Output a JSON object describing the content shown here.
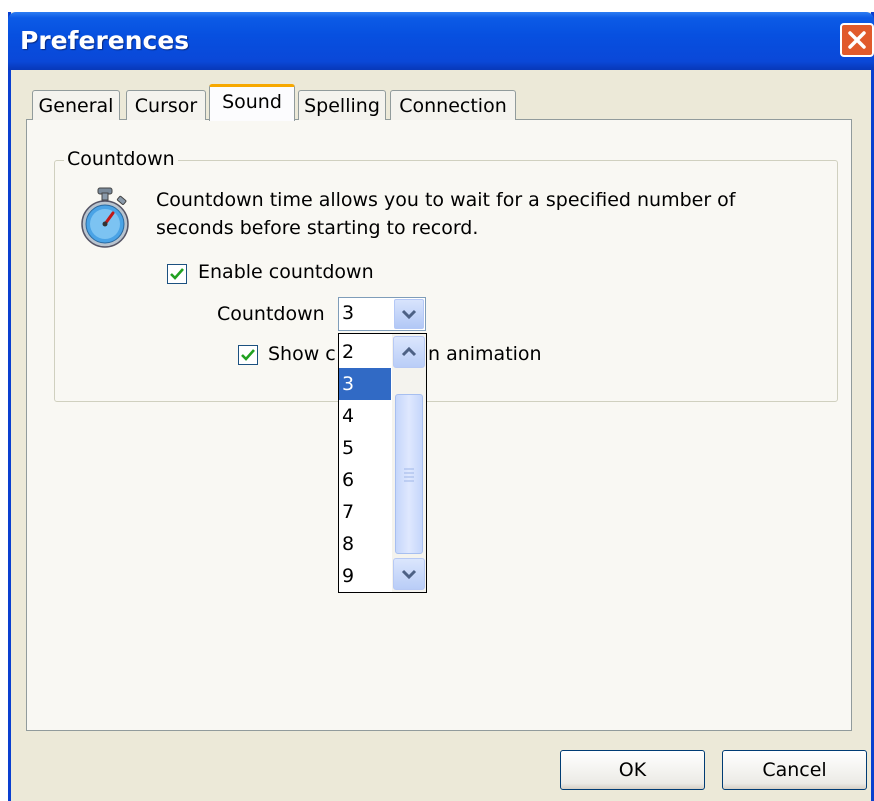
{
  "window": {
    "title": "Preferences"
  },
  "tabs": [
    {
      "label": "General",
      "active": false
    },
    {
      "label": "Cursor",
      "active": false
    },
    {
      "label": "Sound",
      "active": true
    },
    {
      "label": "Spelling",
      "active": false
    },
    {
      "label": "Connection",
      "active": false
    }
  ],
  "countdown_group": {
    "legend": "Countdown",
    "description_line1": "Countdown time allows you to wait for a specified number of",
    "description_line2": "seconds before starting to record.",
    "enable_checkbox": {
      "label": "Enable countdown",
      "checked": true
    },
    "countdown_label": "Countdown",
    "countdown_value": "3",
    "show_animation_checkbox": {
      "label_start": "Show c",
      "label_end": "n animation",
      "checked": true
    }
  },
  "dropdown": {
    "options": [
      "2",
      "3",
      "4",
      "5",
      "6",
      "7",
      "8",
      "9"
    ],
    "selected": "3"
  },
  "buttons": {
    "ok": "OK",
    "cancel": "Cancel"
  },
  "colors": {
    "titlebar": "#0750e0",
    "selection": "#316ac5",
    "active_tab_accent": "#f7a800",
    "close_button": "#e15a2b",
    "checkmark": "#21a121"
  }
}
